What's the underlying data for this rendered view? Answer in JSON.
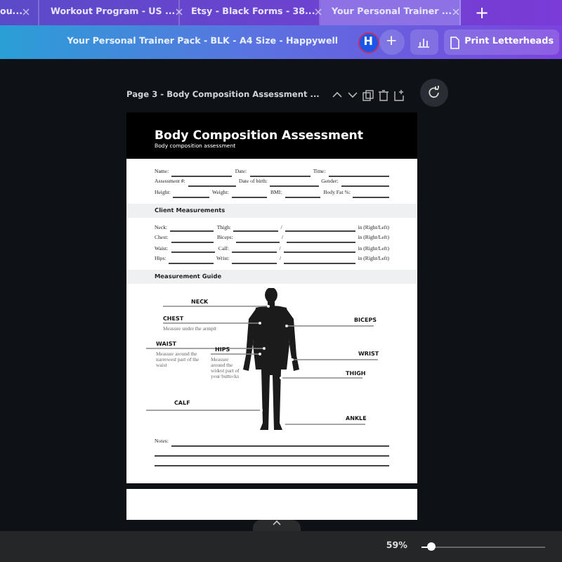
{
  "tabs": [
    {
      "label": "ou...",
      "selected": false
    },
    {
      "label": "Workout Program - US ...",
      "selected": false
    },
    {
      "label": "Etsy - Black Forms - 38...",
      "selected": false
    },
    {
      "label": "Your Personal Trainer ...",
      "selected": true
    }
  ],
  "new_tab": "+",
  "toolbar": {
    "title": "Your Personal Trainer Pack - BLK - A4 Size - Happywell",
    "avatar": "H",
    "add": "+",
    "print_button": "Print Letterheads"
  },
  "page_header": {
    "title": "Page 3 - Body Composition Assessment ..."
  },
  "document": {
    "title": "Body Composition Assessment",
    "subtitle": "Body composition assessment",
    "info_rows": [
      [
        "Name:",
        "Date:",
        "Time:"
      ],
      [
        "Assessment #:",
        "Date of birth:",
        "Gender:"
      ],
      [
        "Height:",
        "Weight:",
        "BMI:",
        "Body Fat %:"
      ]
    ],
    "sections": [
      {
        "heading": "Client Measurements",
        "rows": [
          {
            "left": "Neck:",
            "right": "Thigh:",
            "sep": "/",
            "unit": "in (Right/Left)"
          },
          {
            "left": "Chest:",
            "right": "Biceps:",
            "sep": "/",
            "unit": "in (Right/Left)"
          },
          {
            "left": "Waist:",
            "right": "Calf:",
            "sep": "/",
            "unit": "in (Right/Left)"
          },
          {
            "left": "Hips:",
            "right": "Wrist:",
            "sep": "/",
            "unit": "in (Right/Left)"
          }
        ]
      },
      {
        "heading": "Measurement Guide"
      }
    ],
    "guide_labels": [
      {
        "label": "NECK"
      },
      {
        "label": "CHEST",
        "note": "Measure under the armpit"
      },
      {
        "label": "WAIST",
        "note": "Measure around the narrowest part of the waist"
      },
      {
        "label": "HIPS",
        "note": "Measure around the widest part of your buttocks"
      },
      {
        "label": "CALF"
      },
      {
        "label": "BICEPS"
      },
      {
        "label": "WRIST"
      },
      {
        "label": "THIGH"
      },
      {
        "label": "ANKLE"
      }
    ],
    "notes_label": "Notes:"
  },
  "status_bar": {
    "zoom": "59%",
    "zoom_slider": {
      "level": 0.08
    }
  }
}
